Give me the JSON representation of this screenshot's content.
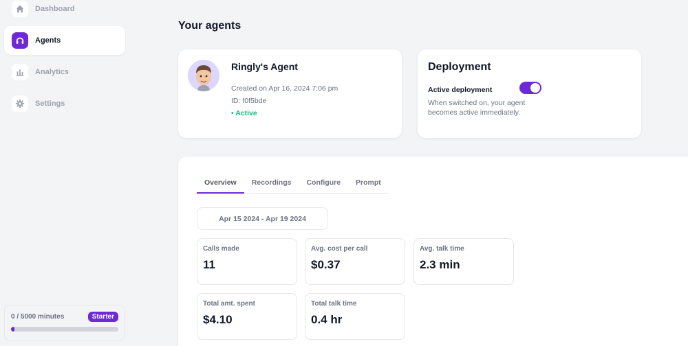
{
  "sidebar": {
    "items": [
      {
        "label": "Dashboard"
      },
      {
        "label": "Agents"
      },
      {
        "label": "Analytics"
      },
      {
        "label": "Settings"
      }
    ],
    "usage": {
      "text": "0 / 5000 minutes",
      "plan": "Starter",
      "progress": 0.03
    }
  },
  "main": {
    "title": "Your agents",
    "agent": {
      "name": "Ringly's Agent",
      "created": "Created on Apr 16, 2024 7:06 pm",
      "id": "ID: f0f5bde",
      "status": "• Active"
    },
    "deployment": {
      "title": "Deployment",
      "label": "Active deployment",
      "enabled": true,
      "description": "When switched on, your agent becomes active immediately."
    },
    "tabs": [
      {
        "label": "Overview"
      },
      {
        "label": "Recordings"
      },
      {
        "label": "Configure"
      },
      {
        "label": "Prompt"
      }
    ],
    "date_range": "Apr 15 2024 - Apr 19 2024",
    "stats": [
      {
        "label": "Calls made",
        "value": "11"
      },
      {
        "label": "Avg. cost per call",
        "value": "$0.37"
      },
      {
        "label": "Avg. talk time",
        "value": "2.3 min"
      },
      {
        "label": "Total amt. spent",
        "value": "$4.10"
      },
      {
        "label": "Total talk time",
        "value": "0.4 hr"
      }
    ]
  },
  "colors": {
    "accent": "#6d28d9",
    "active_status": "#10b981"
  }
}
